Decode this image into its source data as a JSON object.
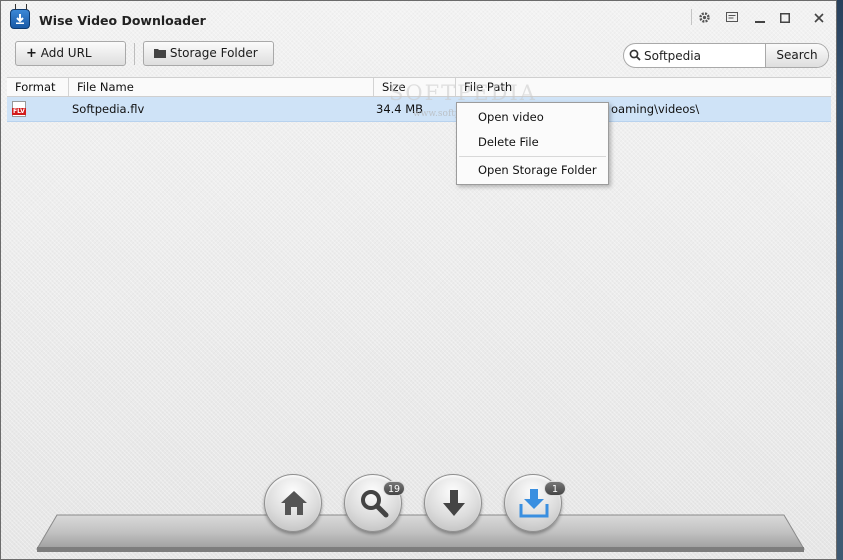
{
  "window": {
    "title": "Wise Video Downloader"
  },
  "titlebar": {
    "icons": [
      "gear-icon",
      "feedback-icon",
      "minimize-icon",
      "maximize-icon",
      "close-icon"
    ]
  },
  "toolbar": {
    "add_url_label": "Add URL",
    "storage_folder_label": "Storage Folder",
    "search_value": "Softpedia",
    "search_button_label": "Search"
  },
  "table": {
    "columns": [
      "Format",
      "File Name",
      "Size",
      "File Path"
    ],
    "rows": [
      {
        "format": "FLV",
        "file_name": "Softpedia.flv",
        "size": "34.4 MB",
        "file_path": "oaming\\videos\\"
      }
    ]
  },
  "watermark": {
    "main": "SOFTPEDIA",
    "sub": "www.softpedia.com"
  },
  "context_menu": {
    "items": [
      "Open video",
      "Delete File",
      "Open Storage Folder"
    ]
  },
  "dock": {
    "buttons": [
      "home-icon",
      "search-icon",
      "download-icon",
      "downloaded-icon"
    ],
    "search_badge": "19",
    "downloaded_badge": "1",
    "accent_color": "#3a8fe0"
  }
}
